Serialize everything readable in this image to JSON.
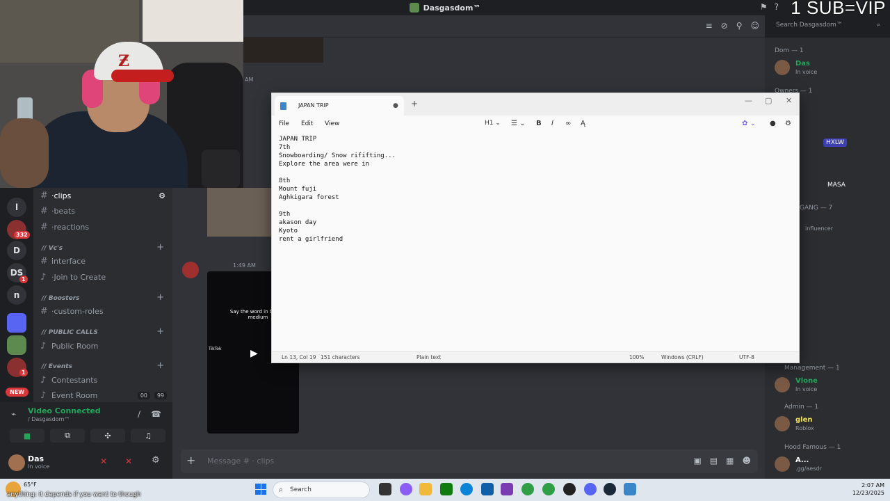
{
  "window": {
    "title": "Dasgasdom™"
  },
  "overlay": {
    "sub_text": "1 SUB=VIP"
  },
  "rail": {
    "letters": [
      "l",
      "D",
      "DS",
      "n"
    ],
    "badges": [
      "332",
      "1",
      "1"
    ],
    "new_label": "NEW"
  },
  "channels": {
    "items": [
      {
        "name": "clips"
      },
      {
        "name": "beats"
      },
      {
        "name": "reactions"
      },
      {
        "name": "interface"
      },
      {
        "name": "Join to Create"
      },
      {
        "name": "custom-roles"
      },
      {
        "name": "Public Room"
      },
      {
        "name": "Contestants"
      },
      {
        "name": "Event Room"
      }
    ],
    "categories": [
      "// Vc's",
      "// Boosters",
      "// PUBLIC CALLS",
      "// Events"
    ],
    "event_room_pill_a": "00",
    "event_room_pill_b": "99"
  },
  "voice": {
    "status": "Video Connected",
    "server": "/ Dasgasdom™"
  },
  "user": {
    "name": "Das",
    "status": "In voice"
  },
  "chat": {
    "search_placeholder": "Search Dasgasdom™",
    "message_placeholder": "Message # · clips",
    "am_label": "AM",
    "msg_time": "1:49 AM",
    "embed_caption": "Say the word in bio lvl: medium",
    "embed_tiktok": "TikTok"
  },
  "members": {
    "groups": [
      {
        "label": "Dom — 1"
      },
      {
        "label": "Owners — 1"
      },
      {
        "label": "GANG — 7"
      },
      {
        "label": "Management — 1"
      },
      {
        "label": "Admin — 1"
      },
      {
        "label": "Hood Famous — 1"
      }
    ],
    "users": [
      {
        "name": "Das",
        "status": "In voice",
        "color": "#23a55a"
      },
      {
        "name": "Vlone",
        "status": "In voice",
        "color": "#23a55a"
      },
      {
        "name": "glen",
        "status": "Roblox",
        "color": "#f0e050"
      },
      {
        "name": "A...",
        "status": ".gg/aesdr",
        "color": "#ffffff"
      }
    ],
    "tag_hxlw": "HXLW",
    "tag_masa": "MASA",
    "influencer": "influencer"
  },
  "notepad": {
    "tab_title": "JAPAN TRIP",
    "menus": [
      "File",
      "Edit",
      "View"
    ],
    "heading_select": "H1",
    "body": "JAPAN TRIP\n7th\nSnowboarding/ Snow rififting...\nExplore the area were in\n\n8th\nMount fuji\nAghkigara forest\n\n9th\nakason day\nKyoto\nrent a girlfriend",
    "status": {
      "position": "Ln 13, Col 19",
      "chars": "151 characters",
      "format": "Plain text",
      "zoom": "100%",
      "eol": "Windows (CRLF)",
      "encoding": "UTF-8"
    }
  },
  "taskbar": {
    "temp": "65°F",
    "caption": "anything: it depends if you want to though",
    "search": "Search",
    "time": "2:07 AM",
    "date": "12/23/2025"
  }
}
